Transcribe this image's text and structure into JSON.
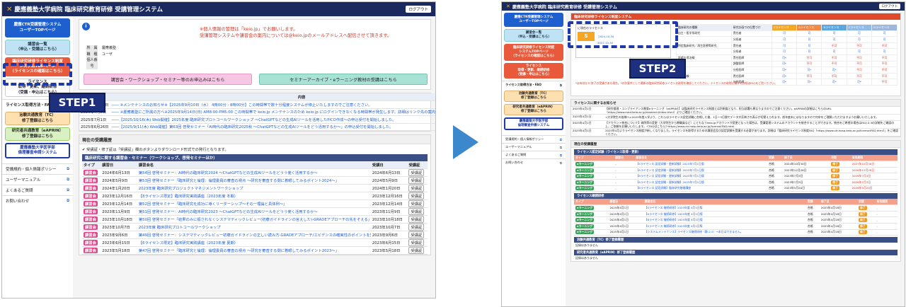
{
  "app_title": "慶應義塾大学病院 臨床研究教育研修 受講管理システム",
  "logout": "ログアウト",
  "s1": {
    "side_buttons": [
      {
        "label": "慶應CTR受講管理システム\nユーザーTOPページ",
        "cls": "b-blue",
        "h": 27
      },
      {
        "label": "講習会一覧\n（申込・受講はこちら）",
        "cls": "b-cyan",
        "h": 22
      },
      {
        "label": "臨床研究研修ライセンス制度\nシステムTOPページ\n（ライセンスの確認はこちら）",
        "cls": "b-red",
        "h": 27
      },
      {
        "label": "ライセンス\n取得・更新、継続研修\n（受講・申込はこちら）",
        "cls": "b-white",
        "h": 26
      }
    ],
    "side_link_top": "ライセンス取得方法・FAQ",
    "side_buttons2": [
      {
        "label": "治験共通教育（TC）\n修了登録はこちら",
        "cls": "b-orange",
        "h": 19
      },
      {
        "label": "研究者共通教育（eAPRIN）\n修了登録はこちら",
        "cls": "b-green",
        "h": 19
      },
      {
        "label": "慶應義塾大学医学部\n倫理審査申請システム",
        "cls": "b-navy",
        "h": 22
      }
    ],
    "side_links": [
      "受講規約・個人情報ポリシー",
      "ユーザーマニュアル",
      "よくあるご質問",
      "お問い合わせ"
    ],
    "notice": "※個人情報の管理は「keio.jp」でお願いします。\n受講管理システムや講習会の案内については@keio.jpのメールアドレスへ配信させて頂きます。",
    "profile": {
      "k1": "所　属",
      "v1": "慶應義塾",
      "k2": "職　種",
      "v2": "ユーザ",
      "k3": "個人番号",
      "v3": ""
    },
    "wide_btn1": "講習会・ワークショップ・セミナー等のお申込みはこちら",
    "wide_btn2": "セミナーアーカイブ・eラーニング教材の受講はこちら",
    "news_title": "お知らせ",
    "news_hdr": [
      "日付",
      "内容"
    ],
    "news": [
      [
        "2025年8月27日",
        "―― ※メンテナンスのお知らせ※【2025年9月10日（水） 4時00分 - 8時00分】この時間帯で数十分程度システムが停止いたしますのでご注意ください。"
      ],
      [
        "2025年7月8日",
        "―― ※慶應義塾にご所属の方へ※2025年9月14日(日) AM8:00-PM5:00 この時間帯で keio.jp メンテナンスのため keio.jp にログインできなくなる時間帯が発生します。詳細はリンク先の案内をご確認ください。(慶應keio.jp)"
      ],
      [
        "2025年7月1日",
        "――【2025/10/16(木) Web開催】2025年度 臨床研究プロトコールワークショップ 〜ChatGPTなどの生成AIツールを活用したPICO作成〜の申込受付を開始しました。"
      ],
      [
        "2025年6月26日",
        "――【2025/9/11(木) Web開催】第63回 啓発セミナー「AI時代の臨床研究2025秋 〜ChatGPTなどの生成AIツールをどう活用するか〜」の申込受付を開始しました。"
      ]
    ],
    "status_title": "現在の受講履歴",
    "status_note": "受講証・修了証は「受講証」欄のボタンよりダウンロード形式での発行となります。",
    "course_section": "臨床研究に関する講習会・セミナー（ワークショップ、啓発セミナーほか）",
    "course_hdr": [
      "タイプ",
      "講習日",
      "講習会名",
      "受講日",
      "受講証"
    ],
    "badge": "講習会",
    "cert": "受講証",
    "courses": [
      [
        "2024年6月13日",
        "第54回 啓発セミナー：AI時代の臨床研究2024 〜ChatGPTなどの生成AIツールをどうう使く活用するか〜",
        "2024年6月13日"
      ],
      [
        "2024年5月9日",
        "第53回 啓発セミナー「臨床研究と倫理：倫理委員の審査の視点 〜研究を審査する側に着眼してみるポイント2024〜」",
        "2024年5月9日"
      ],
      [
        "2024年1月20日",
        "2023年度 臨床研究プロジェクトマネジメントワークショップ",
        "2024年1月20日"
      ],
      [
        "2023年12月16日",
        "【8ライセンス限定】臨床研究実践講座（2023年度 冬期）",
        "2023年12月16日"
      ],
      [
        "2023年12月14日",
        "第52回 啓発セミナー「臨床研究を成功に導くリーダーシップ〜その一理論と具体例〜」",
        "2023年12月14日"
      ],
      [
        "2023年11月9日",
        "第51回 啓発セミナー：AI時代の臨床研究2023 〜ChatGPTなどの生成AIツールをどうう使く活用するか〜",
        "2023年11月9日"
      ],
      [
        "2023年10月18日",
        "第50回 啓発セミナー「結果のみに振されなくシステマティックレビュー(初療ガイドラインの言えした)-GRADEアプローチの先をそえる」（研究デザインbrushup 2）",
        "2023年10月18日"
      ],
      [
        "2023年10月7日",
        "2023年度 臨床研究プロトコールワークショップ",
        "2023年10月7日"
      ],
      [
        "2023年9月6日",
        "第49回 啓発セミナー：システマティックレビュー初療ガイドラインの正しい読み方-GRADEアプローチ/エビデンスの確実性のポイントを整理する（研究デザインBrushup 1）",
        "2023年9月6日"
      ],
      [
        "2023年6月15日",
        "【6ライセンス限定】臨床研究実践講座（2023年度 夏期）",
        "2023年6月15日"
      ],
      [
        "2023年5月18日",
        "第47回 啓発セミナー「臨床研究と倫理：倫理委員の審査の視点 〜研究を審査する側に着眼してみるポイント2023〜」",
        "2023年5月18日"
      ]
    ],
    "step1": "STEP1"
  },
  "s2": {
    "side_buttons": [
      {
        "label": "慶應CTR受講管理システム\nユーザーTOPページ",
        "cls": "b-blue",
        "h": 20
      },
      {
        "label": "講習会一覧\n（申込・受講はこちら）",
        "cls": "b-cyan",
        "h": 18
      },
      {
        "label": "臨床研究研修ライセンス制度\nシステムTOPページ\n（ライセンスの確認はこちら）",
        "cls": "b-red",
        "h": 24
      },
      {
        "label": "ライセンス\n取得・更新、継続研修\n（受講・申込はこちら）",
        "cls": "b-red",
        "h": 22
      }
    ],
    "side_link_top": "ライセンス取得方法・FAQ",
    "side_buttons2": [
      {
        "label": "治験共通教育（TC）\n修了登録はこちら",
        "cls": "b-orange",
        "h": 16
      },
      {
        "label": "研究者共通教育（eAPRIN）\n修了登録はこちら",
        "cls": "b-orange",
        "h": 16
      },
      {
        "label": "慶應義塾大学医学部\n倫理審査申請システム",
        "cls": "b-navy",
        "h": 18
      }
    ],
    "side_links": [
      "受講規約・個人情報ポリシー",
      "ユーザーマニュアル",
      "よくあるご質問",
      "お問い合わせ"
    ],
    "lic_title": "臨床研究研修ライセンス制度システム",
    "lic_label": "に現在のライセンス",
    "lic_grade": "S",
    "lic_from": "2024-10-30",
    "lic_to": "2027-10-30",
    "grid_hdr": [
      "臨床研究の種類",
      "研究計画での位置づけ",
      "Sライセンス",
      "Aライセンス",
      "Bライセンス",
      "Cライセンス",
      "Dライセンス"
    ],
    "grid_rows": [
      [
        "自主・医学系研究",
        "責任者",
        "可",
        "可",
        "可",
        "可",
        "可"
      ],
      [
        "",
        "分担者",
        "可",
        "可",
        "可",
        "可",
        "可"
      ],
      [
        "特定臨床研究／再生医療等研究",
        "責任者",
        "可",
        "可",
        "不可",
        "不可",
        "不可"
      ],
      [
        "",
        "分担者",
        "可",
        "可",
        "可",
        "可",
        "可"
      ],
      [
        "医師主導治験",
        "責任医師",
        "可*",
        "不可",
        "不可",
        "不可",
        "不可"
      ],
      [
        "",
        "調整医師",
        "可*",
        "不可",
        "不可",
        "不可",
        "不可"
      ],
      [
        "",
        "分担医師",
        "可*",
        "可*",
        "可*",
        "不可",
        "不可"
      ],
      [
        "企業治験",
        "責任医師",
        "可*",
        "不可",
        "不可",
        "不可",
        "不可"
      ],
      [
        "",
        "分担医師",
        "可*",
        "可*",
        "可*",
        "可*",
        "不可"
      ]
    ],
    "grid_note": "*は有効なTC修了の受講がある場合。*の別要件として最新の臨床研究研修ライセンス取得を確認してください。ライセンスの取得に関する詳細はFAQをご覧ください。",
    "step2": "STEP2",
    "news_title": "ライセンスに関するお知らせ",
    "news": [
      [
        "2025年4月1日",
        "【研究倫理・コンプライアンス教育eラーニング（eAPRIN）】は臨床研究ライセンス制度とは別制度となり、担当部署も異なりますのでご注意ください。eAPRINの詳細はこちらのURL（https://www.med.keio.ac.jp/research/index.html）よりご確認ください。"
      ],
      [
        "2025年4月1日",
        "<大学院生の皆様へ>2025年度入学より、これらはライセンス認定試験に合格した後、1日〜3日間でデータが反映され表示が切替えられます。前年度末にはなりますので何卒をご理解いただけますようお願いいたします。"
      ],
      [
        "2025年4月1日",
        "【アカウント統合について】病院等の変更（大学院生から教職員など）にともなうkeio.jpアカウントが変更となった場合は、受講管理システムのアカウントを統合することができます。統合をご希望の場合はFAQ 2.3の詳細をご確認の上、ご依頼をお願いいたします。＜FAQはこちら＞https://www.ctr.hosp.keio.ac.jp/license/FAQ.html"
      ],
      [
        "2025年4月1日",
        "2025年4月よりライセンス制度が新しくなりました。ライセンスを取得するための講習会及び認定試験を受講する必要があります。詳細は「臨床研究ライセンス制度FAQ（https://www.ctr.hosp.keio.ac.jp/license/FAQ.html）」をご確認ください。"
      ]
    ],
    "hist_title": "現在の受講履歴",
    "hist_sec1": "ライセンス認定試験（ライセンス取得・更新）",
    "hist_hdr1": [
      "タイプ",
      "講習日",
      "講習会名",
      "受講",
      "修了日",
      "状態",
      "有効期限"
    ],
    "hist1": [
      [
        "eラーニング",
        "-",
        "【Sライセンス 認定試験・更新試験】2023年7月1日版",
        "合格",
        "2024年10月30日",
        "",
        "2027年10月30日"
      ],
      [
        "eラーニング",
        "-",
        "【Aライセンス 認定試験・更新試験】2023年7月1日版",
        "合格",
        "2023年12月28日",
        "",
        "2026年12月28日"
      ],
      [
        "eラーニング",
        "-",
        "【Bライセンス 認定試験・更新試験】2023年7月1日版",
        "合格",
        "2023年7月3日",
        "",
        "2026年7月3日"
      ],
      [
        "eラーニング",
        "-",
        "【Aライセンス 認定試験・更新試験】2023年7月1日版",
        "合格",
        "2023年7月3日",
        "",
        "2026年7月3日"
      ],
      [
        "eラーニング",
        "-",
        "【Bライセンス 認定試験】臨床研究基礎講座",
        "合格",
        "2023年5月20日",
        "",
        "2026年5月20日"
      ]
    ],
    "hist_sec2": "ライセンス継続研修",
    "hist2": [
      [
        "eラーニング",
        "2025年4月1日",
        "【Sライセンス 継続研修】2025年度 4月1日版",
        "合格",
        "2025年4月18日",
        "",
        "-"
      ],
      [
        "eラーニング",
        "2025年4月1日",
        "【Aライセンス 継続研修】2025年度 4月1日版",
        "合格",
        "2025年4月18日",
        "",
        "-"
      ],
      [
        "eラーニング",
        "2025年4月1日",
        "【Bライセンス 継続研修】2025年度 4月1日版",
        "合格",
        "2025年4月18日",
        "",
        "-"
      ],
      [
        "eラーニング",
        "2025年4月1日",
        "【Sライセンス 継続研修】2025年度 4月1日版",
        "合格",
        "2025年4月18日",
        "",
        "-"
      ],
      [
        "eラーニング",
        "2025年4月1日",
        "【システムメンテナンス】ライセンス継続研修（静-2-5）→本日はできません。",
        "合格",
        "2025年4月18日",
        "",
        "-"
      ]
    ],
    "done": "修了",
    "hist_sec3": "治験共通教育（TC）修了登録履歴",
    "hist_sec3_txt": "記録はありません",
    "hist_sec4": "研究者共通教育（eAPRIN）修了登録履歴",
    "hist_sec4_txt": "記録はありません"
  }
}
